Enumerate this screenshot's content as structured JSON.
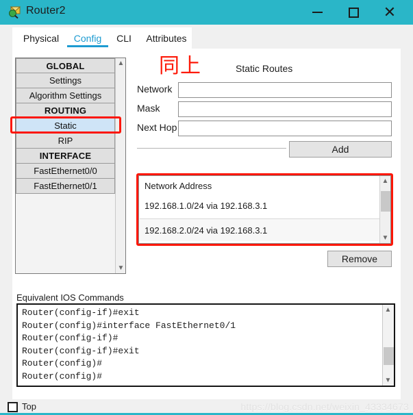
{
  "window": {
    "title": "Router2",
    "icon": "packet-tracer-router-icon",
    "titlebar_color": "#2ab6c8",
    "minimize_label": "—",
    "maximize_label": "□",
    "close_label": "✕"
  },
  "tabs": [
    {
      "label": "Physical",
      "active": false
    },
    {
      "label": "Config",
      "active": true
    },
    {
      "label": "CLI",
      "active": false
    },
    {
      "label": "Attributes",
      "active": false
    }
  ],
  "sidebar": {
    "items": [
      {
        "label": "GLOBAL",
        "type": "header",
        "selected": false
      },
      {
        "label": "Settings",
        "type": "item",
        "selected": false
      },
      {
        "label": "Algorithm Settings",
        "type": "item",
        "selected": false
      },
      {
        "label": "ROUTING",
        "type": "header",
        "selected": false
      },
      {
        "label": "Static",
        "type": "item",
        "selected": true
      },
      {
        "label": "RIP",
        "type": "item",
        "selected": false
      },
      {
        "label": "INTERFACE",
        "type": "header",
        "selected": false
      },
      {
        "label": "FastEthernet0/0",
        "type": "item",
        "selected": false
      },
      {
        "label": "FastEthernet0/1",
        "type": "item",
        "selected": false
      }
    ],
    "scroll_up_icon": "chevron-up-icon",
    "scroll_down_icon": "chevron-down-icon"
  },
  "annotations": {
    "cjk_note": "同上",
    "color": "#fc1708"
  },
  "static_routes": {
    "section_title": "Static Routes",
    "fields": [
      {
        "label": "Network",
        "value": "",
        "placeholder": ""
      },
      {
        "label": "Mask",
        "value": "",
        "placeholder": ""
      },
      {
        "label": "Next Hop",
        "value": "",
        "placeholder": ""
      }
    ],
    "add_label": "Add",
    "remove_label": "Remove",
    "list_header": "Network Address",
    "entries": [
      "192.168.1.0/24 via 192.168.3.1",
      "192.168.2.0/24 via 192.168.3.1"
    ]
  },
  "ios": {
    "label": "Equivalent IOS Commands",
    "lines": "Router(config-if)#exit\nRouter(config)#interface FastEthernet0/1\nRouter(config-if)#\nRouter(config-if)#exit\nRouter(config)#\nRouter(config)#"
  },
  "bottom": {
    "top_label": "Top",
    "top_checked": false,
    "watermark": "https://blog.csdn.net/weixin_43334673"
  }
}
